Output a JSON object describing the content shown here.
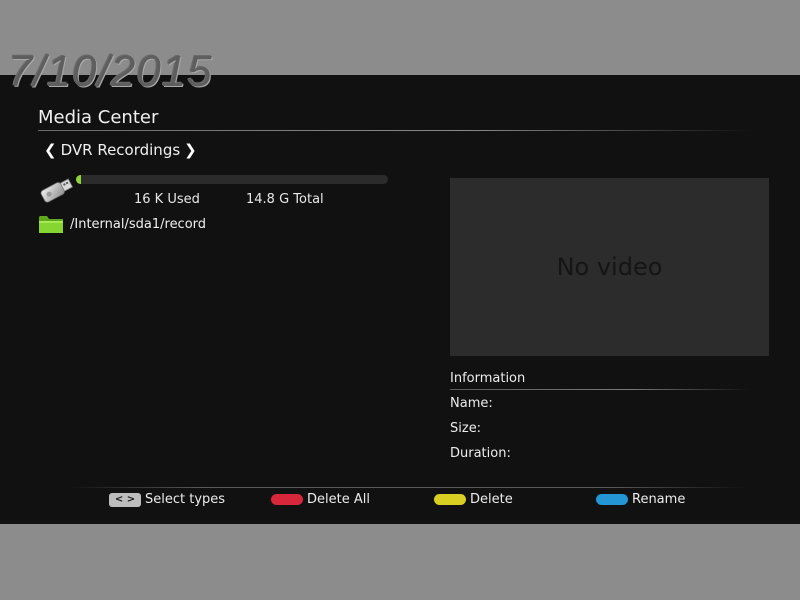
{
  "date_stamp": "7/10/2015",
  "header": {
    "title": "Media Center",
    "media_type": "DVR Recordings"
  },
  "storage": {
    "used_value": "16 K",
    "used_label": "Used",
    "total_value": "14.8 G",
    "total_label": "Total",
    "used_fraction": 0.015
  },
  "folder": {
    "path": "/Internal/sda1/record"
  },
  "preview": {
    "text": "No video"
  },
  "information": {
    "title": "Information",
    "name_label": "Name:",
    "size_label": "Size:",
    "duration_label": "Duration:"
  },
  "footer": {
    "select_types_key": "< >",
    "select_types": "Select types",
    "delete_all": "Delete All",
    "delete": "Delete",
    "rename": "Rename"
  },
  "colors": {
    "red_key": "#d8263a",
    "yellow_key": "#d9cf23",
    "blue_key": "#2496d6",
    "storage_fill": "#8fd43a",
    "folder": "#7ccf2a"
  },
  "icons": {
    "usb": "usb-drive-icon",
    "folder": "folder-icon"
  }
}
